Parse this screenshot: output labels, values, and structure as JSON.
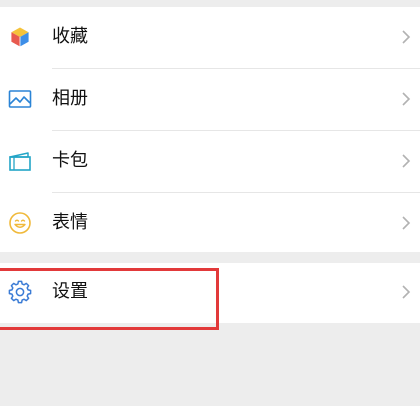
{
  "menu": {
    "items": [
      {
        "label": "收藏",
        "icon": "favorites-cube-icon"
      },
      {
        "label": "相册",
        "icon": "album-picture-icon"
      },
      {
        "label": "卡包",
        "icon": "card-wallet-icon"
      },
      {
        "label": "表情",
        "icon": "sticker-smiley-icon"
      }
    ],
    "settings": {
      "label": "设置",
      "icon": "settings-gear-icon"
    }
  },
  "colors": {
    "background": "#ededed",
    "row": "#ffffff",
    "highlight": "#e2393a",
    "chevron": "#b2b2b2",
    "settings_icon": "#3a7bd5",
    "album_icon": "#2b84d6",
    "card_icon": "#22a5c7",
    "sticker_icon": "#f0b93a"
  }
}
